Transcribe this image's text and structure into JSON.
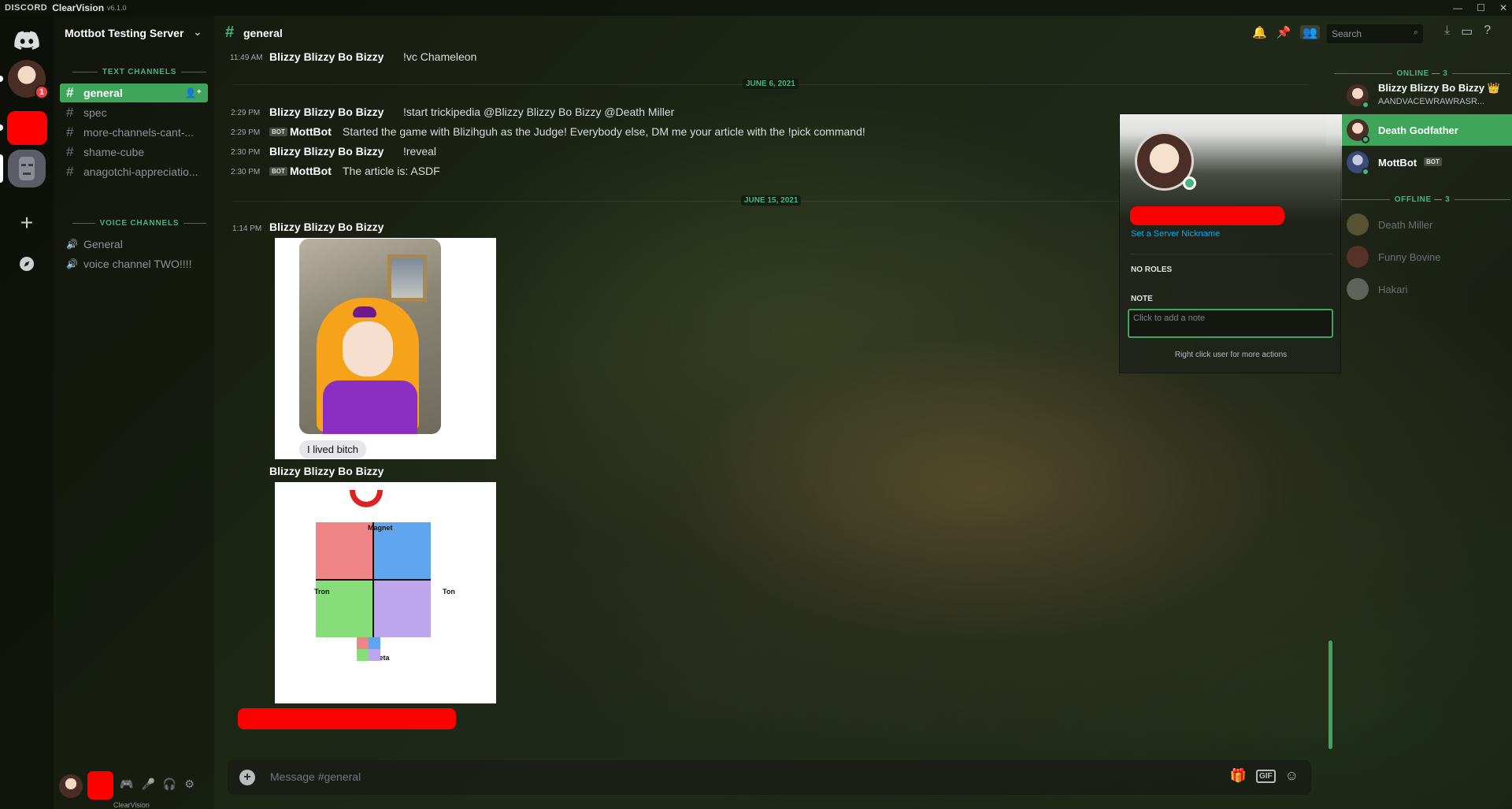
{
  "titlebar": {
    "brand": "DISCORD",
    "app_name": "ClearVision",
    "version": "v6.1.0",
    "minimize": "—",
    "maximize": "☐",
    "close": "✕"
  },
  "guild_rail": {
    "badge_count": "1",
    "add_icon": "+",
    "explore_icon": "🧭"
  },
  "sidebar": {
    "server_name": "Mottbot Testing Server",
    "caret": "⌄",
    "text_category": "TEXT CHANNELS",
    "text_channels": [
      {
        "name": "general",
        "hash": "#",
        "invite": "👤⁺"
      },
      {
        "name": "spec",
        "hash": "#"
      },
      {
        "name": "more-channels-cant-...",
        "hash": "#"
      },
      {
        "name": "shame-cube",
        "hash": "#"
      },
      {
        "name": "anagotchi-appreciatio...",
        "hash": "#"
      }
    ],
    "voice_category": "VOICE CHANNELS",
    "voice_channels": [
      {
        "name": "General",
        "icon": "🔊"
      },
      {
        "name": "voice channel TWO!!!!",
        "icon": "🔊"
      }
    ]
  },
  "user_area": {
    "caption": "ClearVision",
    "icons": [
      "🎮",
      "🎤",
      "🎧",
      "⚙"
    ]
  },
  "header": {
    "channel_hash": "#",
    "channel_name": "general",
    "icons": [
      "🔔",
      "📌",
      "👥"
    ],
    "search_placeholder": "Search",
    "search_icon": "⌕",
    "right_icons": [
      "⤓",
      "▭",
      "?"
    ]
  },
  "messages": {
    "m1": {
      "time": "11:49 AM",
      "author": "Blizzy Blizzy Bo Bizzy",
      "text": "!vc Chameleon"
    },
    "date1": "JUNE 6, 2021",
    "m2": {
      "time": "2:29 PM",
      "author": "Blizzy Blizzy Bo Bizzy",
      "text": "!start trickipedia",
      "mention1": "@Blizzy Blizzy Bo Bizzy",
      "mention2": "@Death Miller"
    },
    "m3": {
      "time": "2:29 PM",
      "bot": "BOT",
      "author": "MottBot",
      "text": "Started the game with Blizihguh as the Judge! Everybody else, DM me your article with the !pick command!"
    },
    "m4": {
      "time": "2:30 PM",
      "author": "Blizzy Blizzy Bo Bizzy",
      "text": "!reveal"
    },
    "m5": {
      "time": "2:30 PM",
      "bot": "BOT",
      "author": "MottBot",
      "text": "The article is: ASDF"
    },
    "date2": "JUNE 15, 2021",
    "m6": {
      "time": "1:14 PM",
      "author": "Blizzy Blizzy Bo Bizzy",
      "bubble": "I lived bitch"
    },
    "m7": {
      "author": "Blizzy Blizzy Bo Bizzy",
      "labels": {
        "top": "Magnet",
        "left": "Tron",
        "right": "Ton",
        "bottom": "Meta"
      }
    }
  },
  "composer": {
    "plus": "+",
    "placeholder": "Message #general",
    "icons": [
      "🎁",
      "GIF",
      "☺"
    ]
  },
  "members": {
    "online_header": "ONLINE — 3",
    "online": [
      {
        "name": "Blizzy Blizzy Bo Bizzy",
        "crown": "👑",
        "status": "AANDVACEWRAWRASR..."
      },
      {
        "name": "Death Godfather"
      },
      {
        "name": "MottBot",
        "bot": "BOT"
      }
    ],
    "offline_header": "OFFLINE — 3",
    "offline": [
      {
        "name": "Death Miller"
      },
      {
        "name": "Funny Bovine"
      },
      {
        "name": "Hakari"
      }
    ]
  },
  "popout": {
    "nickname_link": "Set a Server Nickname",
    "roles_header": "NO ROLES",
    "note_header": "NOTE",
    "note_placeholder": "Click to add a note",
    "footer": "Right click user for more actions"
  },
  "colors": {
    "accent": "#43b581",
    "active": "#3ea55a",
    "redacted": "#ff0000"
  }
}
